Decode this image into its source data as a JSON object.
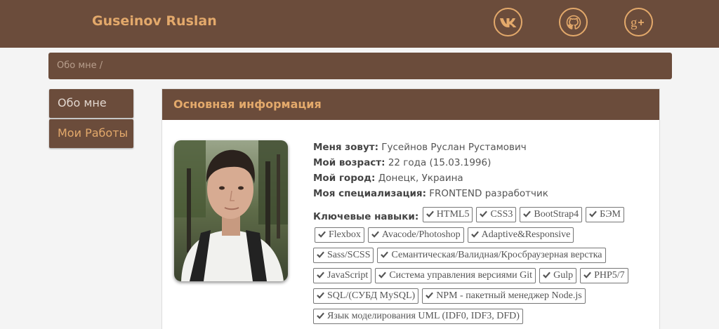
{
  "header": {
    "brand": "Guseinov Ruslan",
    "social": [
      {
        "icon": "vk-icon",
        "label": "VK"
      },
      {
        "icon": "github-icon",
        "label": "GitHub"
      },
      {
        "icon": "google-plus-icon",
        "label": "Google+"
      }
    ]
  },
  "breadcrumb": "Обо мне /",
  "sidebar": {
    "items": [
      {
        "label": "Обо мне"
      },
      {
        "label": "Мои Работы"
      }
    ]
  },
  "panel": {
    "title": "Основная информация",
    "rows": [
      {
        "label": "Меня зовут:",
        "value": " Гусейнов Руслан Рустамович"
      },
      {
        "label": "Мой возраст:",
        "value": " 22 года (15.03.1996)"
      },
      {
        "label": "Мой город:",
        "value": " Донецк, Украина"
      },
      {
        "label": "Моя специализация:",
        "value": " FRONTEND разработчик"
      }
    ],
    "skills_label": "Ключевые навыки:",
    "skills": [
      "HTML5",
      "CSS3",
      "BootStrap4",
      "БЭМ",
      "Flexbox",
      "Avacode/Photoshop",
      "Adaptive&Responsive",
      "Sass/SCSS",
      "Семантическая/Валидная/Кросбраузерная верстка",
      "JavaScript",
      "Система управления версиями Git",
      "Gulp",
      "PHP5/7",
      "SQL/(СУБД MySQL)",
      "NPM - пакетный менеджер Node.js",
      "Язык моделирования UML (IDF0, IDF3, DFD)"
    ]
  },
  "colors": {
    "brown": "#6b4c3b",
    "accent": "#e3a96b",
    "background": "#f4f4f4"
  }
}
